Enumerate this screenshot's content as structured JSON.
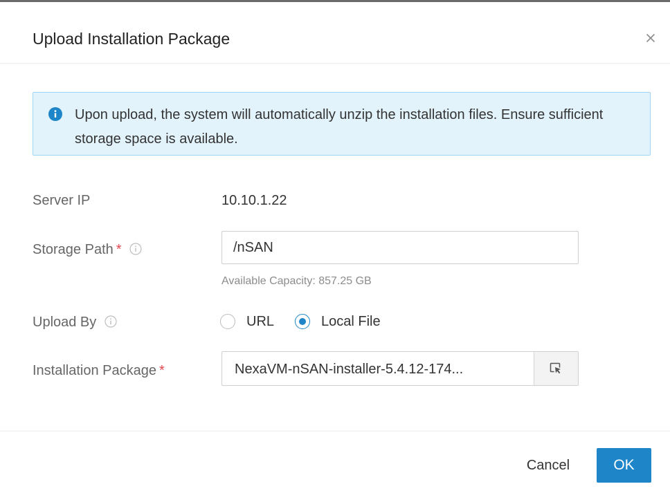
{
  "dialog": {
    "title": "Upload Installation Package",
    "close_icon": "close-icon"
  },
  "alert": {
    "icon": "info-filled-icon",
    "text": "Upon upload, the system will automatically unzip the installation files. Ensure sufficient storage space is available."
  },
  "form": {
    "server_ip": {
      "label": "Server IP",
      "value": "10.10.1.22"
    },
    "storage_path": {
      "label": "Storage Path",
      "required_mark": "*",
      "info_icon": "info-outline-icon",
      "value": "/nSAN",
      "helper": "Available Capacity: 857.25 GB"
    },
    "upload_by": {
      "label": "Upload By",
      "info_icon": "info-outline-icon",
      "options": [
        {
          "label": "URL",
          "checked": false
        },
        {
          "label": "Local File",
          "checked": true
        }
      ]
    },
    "installation_package": {
      "label": "Installation Package",
      "required_mark": "*",
      "file_name": "NexaVM-nSAN-installer-5.4.12-174...",
      "browse_icon": "select-file-cursor-icon"
    }
  },
  "footer": {
    "cancel_label": "Cancel",
    "ok_label": "OK"
  },
  "colors": {
    "primary": "#1e86c8",
    "alert_bg": "#e3f3fc",
    "alert_border": "#9fd5f2",
    "required": "#e5484d"
  }
}
